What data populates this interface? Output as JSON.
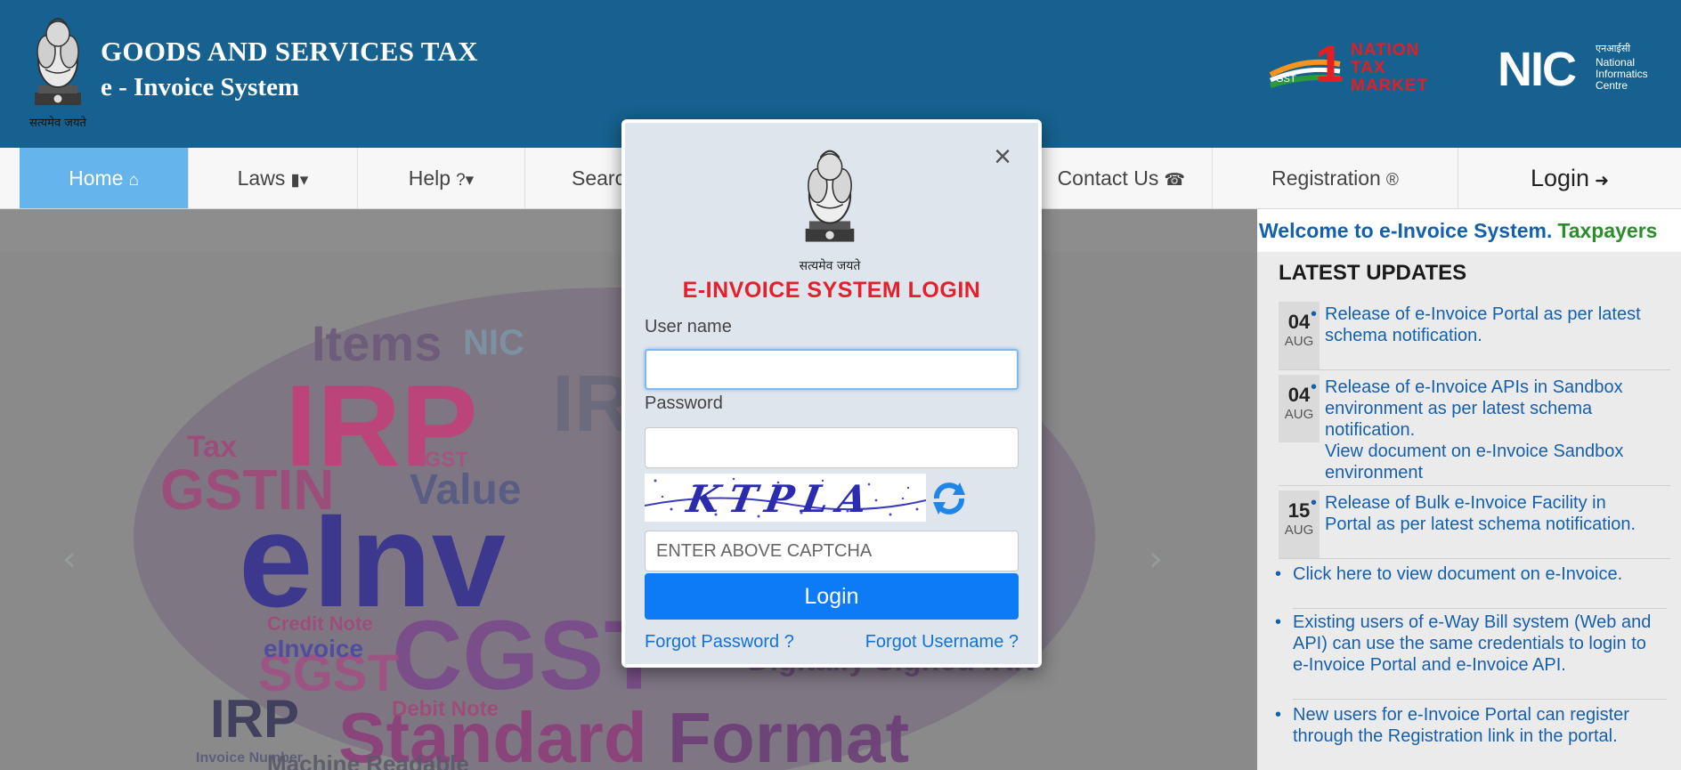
{
  "header": {
    "title": "GOODS AND SERVICES TAX",
    "subtitle": "e - Invoice System",
    "motto": "सत्यमेव जयते",
    "ontm_logo": {
      "line1": "NATION",
      "line2": "TAX",
      "line3": "MARKET",
      "badge": "GST"
    },
    "nic_logo": {
      "mark": "NIC",
      "hindi": "एनआईसी",
      "line1": "National",
      "line2": "Informatics",
      "line3": "Centre"
    }
  },
  "nav": {
    "items": [
      {
        "label": "Home",
        "icon": "home-icon"
      },
      {
        "label": "Laws",
        "icon": "book-dropdown-icon"
      },
      {
        "label": "Help",
        "icon": "question-dropdown-icon"
      },
      {
        "label": "Search",
        "icon": "search-icon"
      },
      {
        "label": "Contact Us",
        "icon": "phone-icon"
      },
      {
        "label": "Registration",
        "icon": "registered-icon"
      },
      {
        "label": "Login",
        "icon": "sign-in-icon"
      }
    ]
  },
  "ticker": {
    "text1": "Welcome to e-Invoice System.",
    "text2": "Taxpayers"
  },
  "updates": {
    "title": "LATEST UPDATES",
    "dated": [
      {
        "day": "04",
        "month": "AUG",
        "text": "Release of e-Invoice Portal as per latest schema notification."
      },
      {
        "day": "04",
        "month": "AUG",
        "text": "Release of e-Invoice APIs in Sandbox environment as per latest schema notification.",
        "link": "View document on e-Invoice Sandbox environment"
      },
      {
        "day": "15",
        "month": "AUG",
        "text": "Release of Bulk e-Invoice Facility in Portal as per latest schema notification."
      }
    ],
    "links": [
      "Click here to view document on e-Invoice.",
      "Existing users of e-Way Bill system (Web and API) can use the same credentials to login to e-Invoice Portal and e-Invoice API.",
      "New users for e-Invoice Portal can register through the Registration link in the portal."
    ]
  },
  "hero": {
    "words": [
      "IRP",
      "eInv",
      "CGST",
      "Standard",
      "Format",
      "SGST",
      "IGST",
      "GSTIN",
      "Value",
      "IRN",
      "Items",
      "NIC",
      "Credit Note",
      "eInvoice",
      "Digitally Signed IRN",
      "Debit Note",
      "Tax",
      "Invoice Number",
      "Machine Readable",
      "IRP"
    ]
  },
  "modal": {
    "motto": "सत्यमेव जयते",
    "title": "E-INVOICE SYSTEM LOGIN",
    "username_label": "User name",
    "username_value": "",
    "password_label": "Password",
    "password_value": "",
    "captcha_text": "KTPLA",
    "captcha_placeholder": "ENTER ABOVE CAPTCHA",
    "login_label": "Login",
    "forgot_password": "Forgot Password ?",
    "forgot_username": "Forgot Username ?"
  },
  "colors": {
    "header_bg": "#16618f",
    "nav_active": "#66b4ec",
    "modal_title": "#e3202b",
    "button": "#0d7bf5",
    "link": "#1560ad"
  }
}
